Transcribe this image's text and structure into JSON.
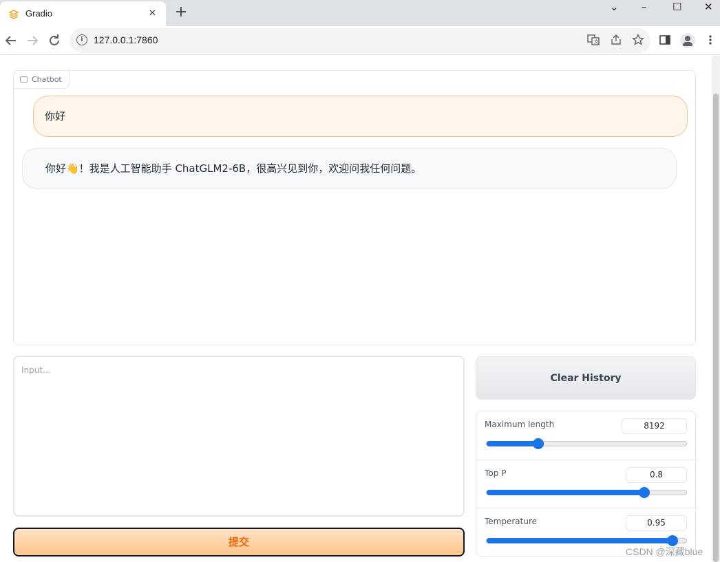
{
  "browser": {
    "tab_title": "Gradio",
    "tab_close": "✕",
    "new_tab": "+",
    "url": "127.0.0.1:7860",
    "window_controls": {
      "dropdown": "⌄",
      "minimize": "–",
      "maximize": "☐",
      "close": "✕"
    },
    "icons": [
      "back-arrow-icon",
      "forward-arrow-icon",
      "reload-icon",
      "info-icon",
      "translate-icon",
      "share-icon",
      "star-icon",
      "sidepanel-icon",
      "profile-icon",
      "more-vert-icon"
    ]
  },
  "chatbot": {
    "label": "Chatbot",
    "messages": [
      {
        "role": "user",
        "text": "你好"
      },
      {
        "role": "bot",
        "text": "你好👋！我是人工智能助手 ChatGLM2-6B，很高兴见到你，欢迎问我任何问题。"
      }
    ]
  },
  "input": {
    "placeholder": "Input...",
    "value": ""
  },
  "submit_label": "提交",
  "clear_label": "Clear History",
  "sliders": [
    {
      "label": "Maximum length",
      "value": "8192",
      "fraction": 0.26
    },
    {
      "label": "Top P",
      "value": "0.8",
      "fraction": 0.79
    },
    {
      "label": "Temperature",
      "value": "0.95",
      "fraction": 0.93
    }
  ],
  "watermark": "CSDN @深藏blue",
  "colors": {
    "accent": "#1a73e8",
    "submit_text": "#ea6a0b",
    "user_bubble": "#fff5eb",
    "user_border": "#f5c489"
  }
}
